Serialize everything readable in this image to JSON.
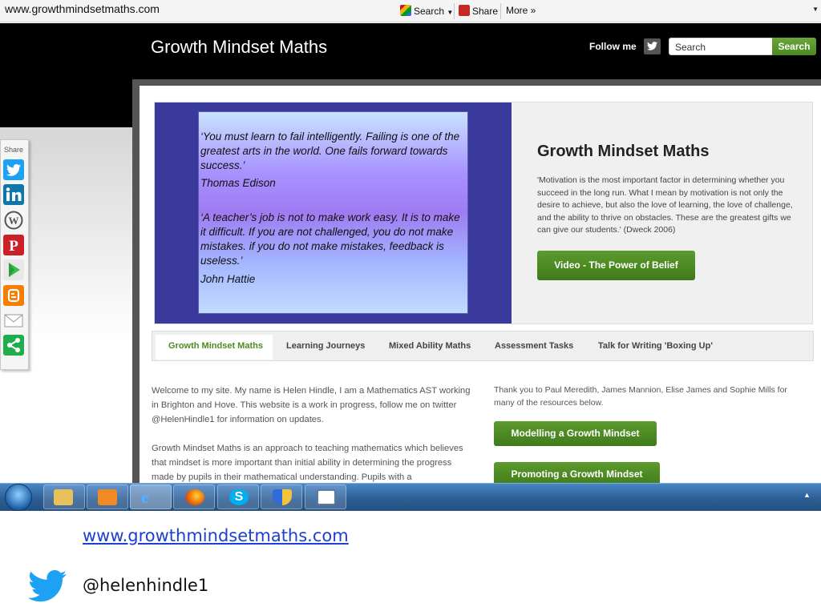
{
  "browser": {
    "close_glyph": "x",
    "url": "www.growthmindsetmaths.com",
    "search_label": "Search",
    "share_label": "Share",
    "more_label": "More »"
  },
  "site": {
    "title": "Growth Mindset Maths",
    "follow_label": "Follow me",
    "search_value": "Search",
    "search_button": "Search"
  },
  "hero": {
    "quote1": "‘You must learn to fail intelligently. Failing is one of the greatest arts in the world. One fails forward towards success.’",
    "author1": "Thomas Edison",
    "quote2": "‘A teacher’s job is not to make work easy. It is to make it difficult. If you are not challenged, you do not make mistakes. if you do not make mistakes, feedback is useless.’",
    "author2": "John Hattie",
    "title": "Growth Mindset Maths",
    "text": "'Motivation is the most important factor in determining whether you succeed in the long run. What I mean by motivation is not only the desire to achieve, but also the love of learning, the love of challenge, and the ability to thrive on obstacles. These are the greatest gifts we can give our students.' (Dweck 2006)",
    "video_button": "Video - The Power of Belief"
  },
  "tabs": [
    {
      "label": "Growth Mindset Maths"
    },
    {
      "label": "Learning Journeys"
    },
    {
      "label": "Mixed Ability Maths"
    },
    {
      "label": "Assessment Tasks"
    },
    {
      "label": "Talk for Writing 'Boxing Up'"
    }
  ],
  "main": {
    "welcome": "Welcome to my site. My name is Helen Hindle, I am a Mathematics AST working in Brighton and Hove. This website is a work in progress, follow me on twitter @HelenHindle1 for information on updates.",
    "approach": "Growth Mindset Maths is an approach to teaching mathematics which believes that mindset is more important than initial ability in determining the progress made by pupils in their mathematical understanding. Pupils with a",
    "thanks": "Thank you to Paul Meredith, James Mannion, Elise James and Sophie Mills for many of the resources below.",
    "btn_modelling": "Modelling a Growth Mindset",
    "btn_promoting": "Promoting a Growth Mindset"
  },
  "sharebar": {
    "label": "Share"
  },
  "footer": {
    "link": "www.growthmindsetmaths.com",
    "handle": "@helenhindle1"
  },
  "colors": {
    "accent_green": "#4d8a22",
    "link_blue": "#1c3fd4",
    "twitter_blue": "#1da1f2"
  }
}
